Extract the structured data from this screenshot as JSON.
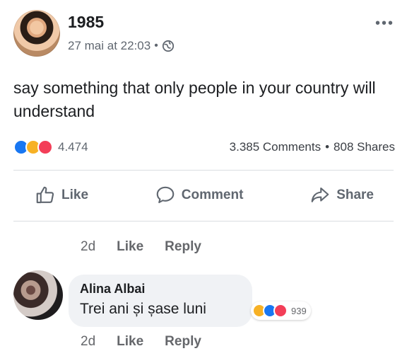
{
  "post": {
    "author": "1985",
    "timestamp": "27 mai at 22:03",
    "privacy_icon": "globe-icon",
    "more_icon": "more-options-icon",
    "more_label": "•••",
    "text": "say something that only people in your country will understand",
    "reactions": {
      "icons": [
        "like",
        "haha",
        "love"
      ],
      "count": "4.474"
    },
    "comments_count": "3.385 Comments",
    "shares_count": "808 Shares",
    "separator": "•",
    "actions": {
      "like": "Like",
      "comment": "Comment",
      "share": "Share"
    }
  },
  "comment_thread": {
    "previous_meta": {
      "time": "2d",
      "like": "Like",
      "reply": "Reply"
    },
    "comment": {
      "author": "Alina Albai",
      "text": "Trei ani și șase luni",
      "reactions": {
        "icons": [
          "haha",
          "like",
          "love"
        ],
        "count": "939"
      },
      "meta": {
        "time": "2d",
        "like": "Like",
        "reply": "Reply"
      }
    }
  },
  "colors": {
    "like": "#1877f2",
    "haha": "#f7b125",
    "love": "#f33e58",
    "muted_text": "#606770"
  }
}
